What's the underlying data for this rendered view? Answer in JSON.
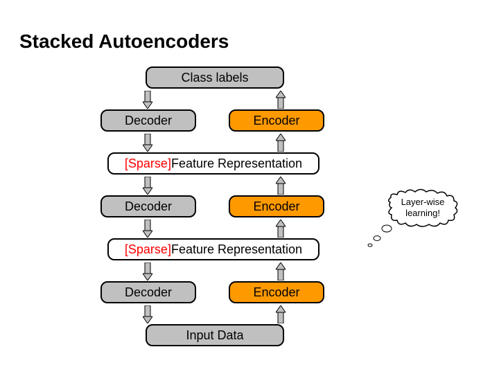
{
  "title": "Stacked Autoencoders",
  "boxes": {
    "class_labels": "Class labels",
    "decoder": "Decoder",
    "encoder": "Encoder",
    "sparse_prefix": "[Sparse]",
    "feature_rep_rest": " Feature Representation",
    "input_data": "Input Data"
  },
  "annotation": "Layer-wise learning!"
}
